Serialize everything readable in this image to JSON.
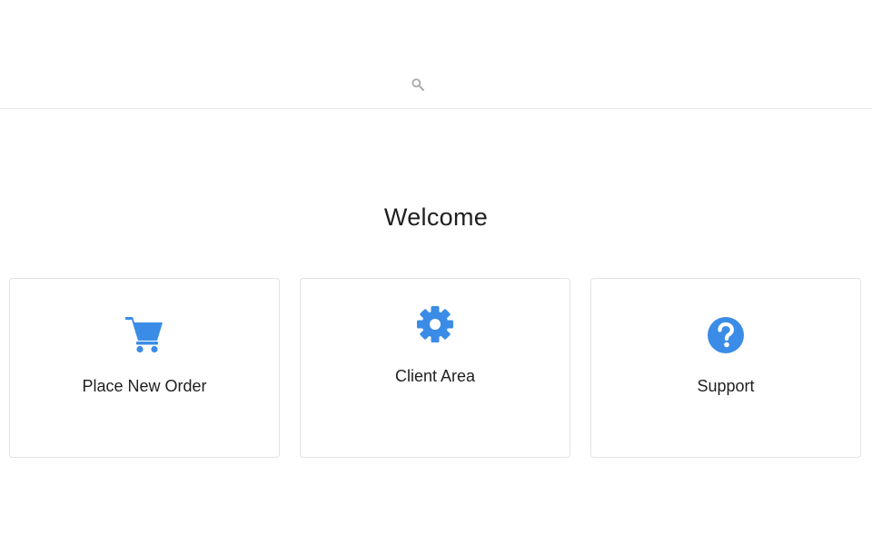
{
  "header": {
    "search_icon": "search-icon"
  },
  "main": {
    "welcome_title": "Welcome",
    "cards": [
      {
        "label": "Place New Order",
        "icon": "cart-icon"
      },
      {
        "label": "Client Area",
        "icon": "gear-icon"
      },
      {
        "label": "Support",
        "icon": "help-circle-icon"
      }
    ]
  },
  "colors": {
    "accent": "#3a8ce6",
    "search_icon": "#a8a8a8",
    "border": "#e3e3e3"
  }
}
